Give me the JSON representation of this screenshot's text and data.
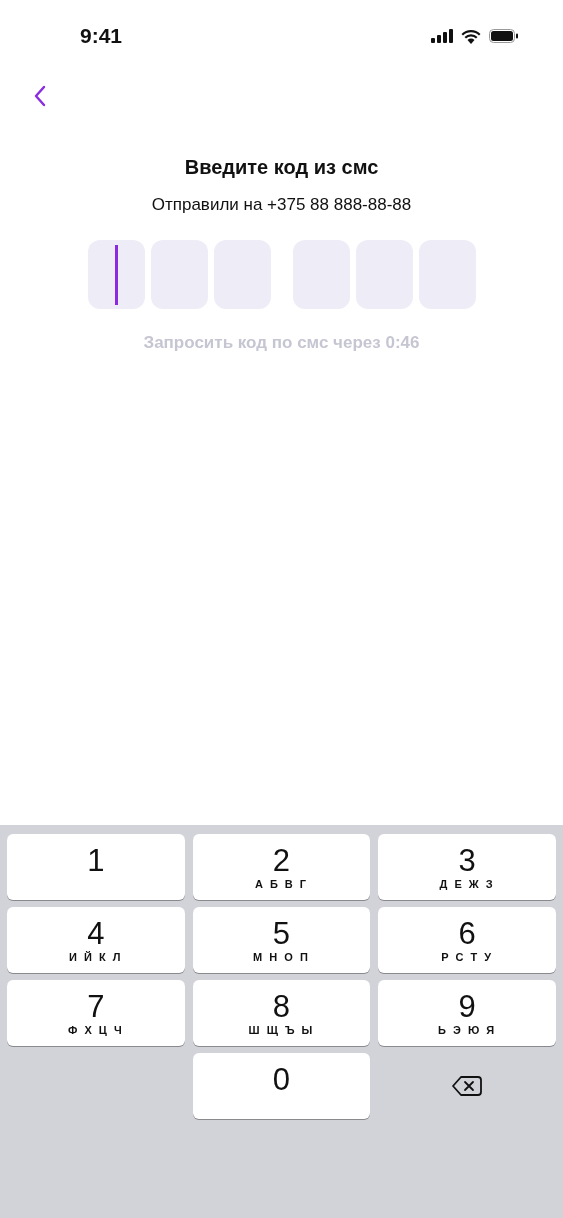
{
  "status_bar": {
    "time": "9:41"
  },
  "title": "Введите код из смс",
  "subtitle": "Отправили на +375 88 888-88-88",
  "code_cells": [
    {
      "selected": true
    },
    {
      "selected": false
    },
    {
      "selected": false
    },
    {
      "selected": false
    },
    {
      "selected": false
    },
    {
      "selected": false
    }
  ],
  "resend_hint": "Запросить код по смс через 0:46",
  "keypad": [
    {
      "kind": "digit",
      "digit": "1"
    },
    {
      "kind": "digit",
      "digit": "2",
      "letters": "А Б В Г"
    },
    {
      "kind": "digit",
      "digit": "3",
      "letters": "Д Е Ж З"
    },
    {
      "kind": "digit",
      "digit": "4",
      "letters": "И Й К Л"
    },
    {
      "kind": "digit",
      "digit": "5",
      "letters": "М Н О П"
    },
    {
      "kind": "digit",
      "digit": "6",
      "letters": "Р С Т У"
    },
    {
      "kind": "digit",
      "digit": "7",
      "letters": "Ф Х Ц Ч"
    },
    {
      "kind": "digit",
      "digit": "8",
      "letters": "Ш Щ Ъ Ы"
    },
    {
      "kind": "digit",
      "digit": "9",
      "letters": "Ь Э Ю Я"
    },
    {
      "kind": "empty"
    },
    {
      "kind": "digit",
      "digit": "0"
    },
    {
      "kind": "delete"
    }
  ]
}
